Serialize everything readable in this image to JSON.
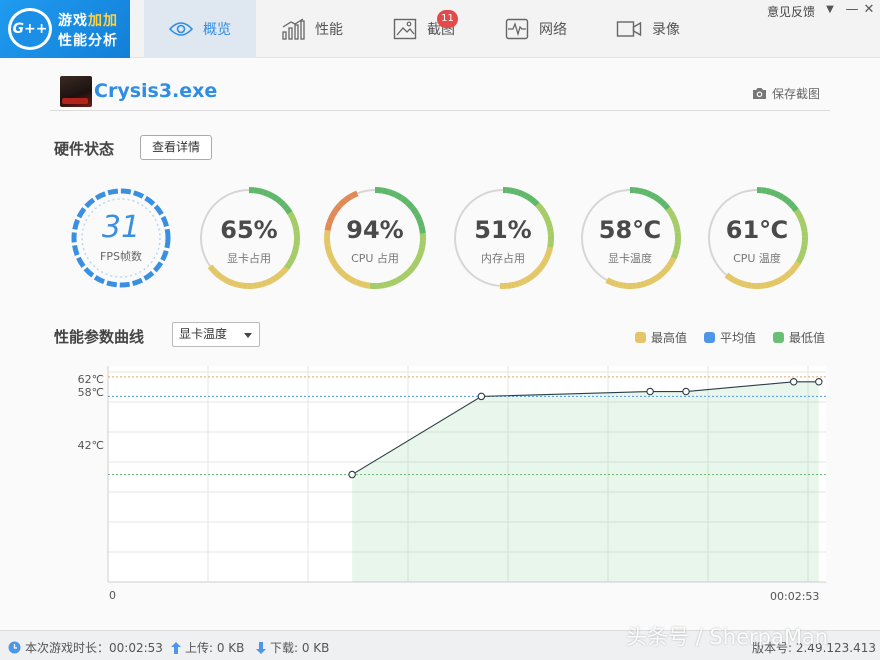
{
  "app": {
    "logo_line1_a": "游戏",
    "logo_line1_b": "加加",
    "logo_line2": "性能分析",
    "logo_mark": "G++"
  },
  "tabs": [
    {
      "label": "概览",
      "icon": "eye-icon",
      "active": true
    },
    {
      "label": "性能",
      "icon": "bar-chart-icon",
      "active": false
    },
    {
      "label": "截图",
      "icon": "image-icon",
      "active": false,
      "badge": "11"
    },
    {
      "label": "网络",
      "icon": "pulse-icon",
      "active": false
    },
    {
      "label": "录像",
      "icon": "video-camera-icon",
      "active": false
    }
  ],
  "header": {
    "feedback": "意见反馈",
    "menu_glyph": "▼",
    "minimize_glyph": "—",
    "close_glyph": "✕"
  },
  "game": {
    "name": "Crysis3.exe",
    "save_screenshot": "保存截图"
  },
  "hardware": {
    "title": "硬件状态",
    "detail_button": "查看详情",
    "fps": {
      "value": "31",
      "label": "FPS帧数"
    },
    "gauges": [
      {
        "value": "65%",
        "label": "显卡占用",
        "level": 0.65
      },
      {
        "value": "94%",
        "label": "CPU 占用",
        "level": 0.94
      },
      {
        "value": "51%",
        "label": "内存占用",
        "level": 0.51
      },
      {
        "value": "58℃",
        "label": "显卡温度",
        "level": 0.58
      },
      {
        "value": "61℃",
        "label": "CPU 温度",
        "level": 0.61
      }
    ]
  },
  "curve": {
    "title": "性能参数曲线",
    "selected_metric": "显卡温度",
    "legend": [
      {
        "label": "最高值",
        "color": "#e8c468"
      },
      {
        "label": "平均值",
        "color": "#4f96e8"
      },
      {
        "label": "最低值",
        "color": "#6bbf74"
      }
    ],
    "y_labels": {
      "max": "62℃",
      "avg": "58℃",
      "min": "42℃"
    },
    "x_start": "0",
    "x_end": "00:02:53"
  },
  "chart_data": {
    "type": "area",
    "title": "",
    "xlabel": "",
    "ylabel": "",
    "x_range": [
      "0",
      "00:02:53"
    ],
    "series": [
      {
        "values": [
          42,
          58,
          59,
          59,
          61,
          61
        ]
      }
    ],
    "sample_positions": [
      0.34,
      0.52,
      0.755,
      0.805,
      0.955,
      0.99
    ],
    "reference_lines": {
      "max": 62,
      "avg": 58,
      "min": 42
    },
    "y_view": [
      20,
      63
    ],
    "grid": true
  },
  "status": {
    "duration": "本次游戏时长：00:02:53",
    "upload": "上传: 0 KB",
    "download": "下载: 0 KB",
    "version": "版本号: 2.49.123.413"
  },
  "watermark": "头条号 / SherpaMan"
}
